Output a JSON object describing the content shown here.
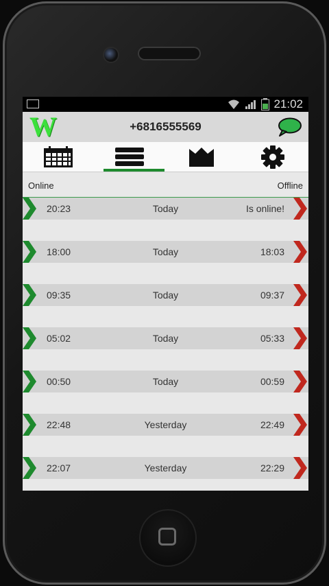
{
  "status": {
    "time": "21:02"
  },
  "header": {
    "logo_letter": "W",
    "phone_number": "+6816555569"
  },
  "tabs": [
    {
      "name": "calendar-icon",
      "active": false
    },
    {
      "name": "list-icon",
      "active": true
    },
    {
      "name": "crown-icon",
      "active": false
    },
    {
      "name": "gear-icon",
      "active": false
    }
  ],
  "columns": {
    "online": "Online",
    "offline": "Offline"
  },
  "sessions": [
    {
      "online": "20:23",
      "day": "Today",
      "offline": "Is online!"
    },
    {
      "online": "18:00",
      "day": "Today",
      "offline": "18:03"
    },
    {
      "online": "09:35",
      "day": "Today",
      "offline": "09:37"
    },
    {
      "online": "05:02",
      "day": "Today",
      "offline": "05:33"
    },
    {
      "online": "00:50",
      "day": "Today",
      "offline": "00:59"
    },
    {
      "online": "22:48",
      "day": "Yesterday",
      "offline": "22:49"
    },
    {
      "online": "22:07",
      "day": "Yesterday",
      "offline": "22:29"
    }
  ],
  "colors": {
    "accent_green": "#1e8a2e",
    "offline_red": "#c0281e",
    "logo_green": "#3ce03c"
  }
}
